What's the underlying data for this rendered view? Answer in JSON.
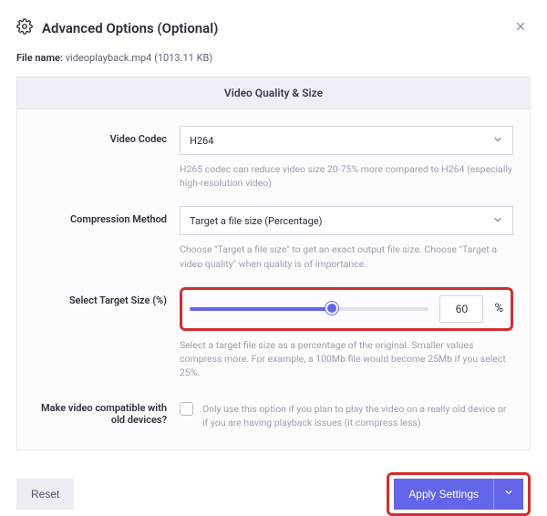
{
  "header": {
    "title": "Advanced Options (Optional)"
  },
  "file": {
    "label": "File name:",
    "value": "videoplayback.mp4 (1013.11 KB)"
  },
  "panel": {
    "title": "Video Quality & Size"
  },
  "codec": {
    "label": "Video Codec",
    "value": "H264",
    "help": "H265 codec can reduce video size 20-75% more compared to H264 (especially high-resolution video)"
  },
  "compression": {
    "label": "Compression Method",
    "value": "Target a file size (Percentage)",
    "help": "Choose \"Target a file size\" to get an exact output file size. Choose \"Target a video quality\" when quality is of importance."
  },
  "target": {
    "label": "Select Target Size (%)",
    "value": "60",
    "unit": "%",
    "help": "Select a target file size as a percentage of the original. Smaller values compress more. For example, a 100Mb file would become 25Mb if you select 25%."
  },
  "compat": {
    "label": "Make video compatible with old devices?",
    "help": "Only use this option if you plan to play the video on a really old device or if you are having playback issues (it compress less)"
  },
  "footer": {
    "reset": "Reset",
    "apply": "Apply Settings"
  }
}
